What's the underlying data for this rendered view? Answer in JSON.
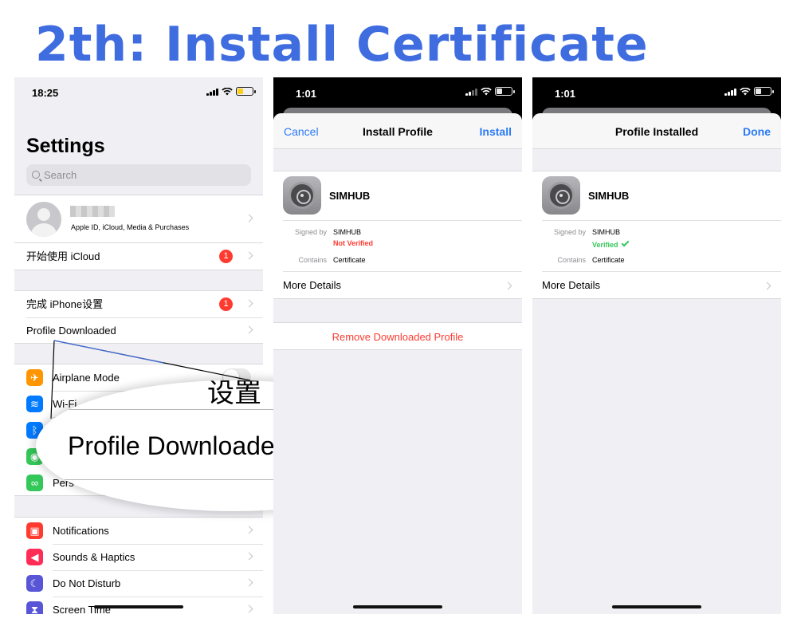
{
  "headline": "2th: Install Certificate",
  "phone1": {
    "time": "18:25",
    "title": "Settings",
    "search_placeholder": "Search",
    "account_subtitle": "Apple ID, iCloud, Media & Purchases",
    "rows_a": [
      {
        "label": "开始使用 iCloud",
        "badge": "1"
      }
    ],
    "rows_b": [
      {
        "label": "完成 iPhone设置",
        "badge": "1"
      },
      {
        "label": "Profile Downloaded"
      }
    ],
    "rows_c": [
      {
        "label": "Airplane Mode",
        "color": "#ff9500",
        "icon": "airplane-icon"
      },
      {
        "label": "Wi-Fi",
        "color": "#007aff",
        "icon": "wifi-icon"
      },
      {
        "label": "",
        "color": "#007aff",
        "icon": "bluetooth-icon"
      },
      {
        "label": "",
        "color": "#34c759",
        "icon": "cellular-icon"
      },
      {
        "label": "Pers",
        "color": "#34c759",
        "icon": "hotspot-icon"
      }
    ],
    "rows_d": [
      {
        "label": "Notifications",
        "color": "#ff3b30",
        "icon": "notifications-icon"
      },
      {
        "label": "Sounds & Haptics",
        "color": "#ff2d55",
        "icon": "sounds-icon"
      },
      {
        "label": "Do Not Disturb",
        "color": "#5856d6",
        "icon": "moon-icon"
      },
      {
        "label": "Screen Time",
        "color": "#5856d6",
        "icon": "hourglass-icon"
      }
    ],
    "magnifier_text": "Profile Downloaded",
    "magnifier_fragment": "设置"
  },
  "phone2": {
    "time": "1:01",
    "nav_left": "Cancel",
    "nav_title": "Install Profile",
    "nav_right": "Install",
    "app_name": "SIMHUB",
    "signed_by_label": "Signed by",
    "signed_by_value": "SIMHUB",
    "status": "Not Verified",
    "contains_label": "Contains",
    "contains_value": "Certificate",
    "more_details": "More Details",
    "remove": "Remove Downloaded Profile"
  },
  "phone3": {
    "time": "1:01",
    "nav_title": "Profile Installed",
    "nav_right": "Done",
    "app_name": "SIMHUB",
    "signed_by_label": "Signed by",
    "signed_by_value": "SIMHUB",
    "status": "Verified",
    "contains_label": "Contains",
    "contains_value": "Certificate",
    "more_details": "More Details"
  },
  "colors": {
    "headline": "#3f6de0",
    "ios_blue": "#2a7af5",
    "ios_red": "#ff3b30",
    "ios_green": "#34c759"
  }
}
